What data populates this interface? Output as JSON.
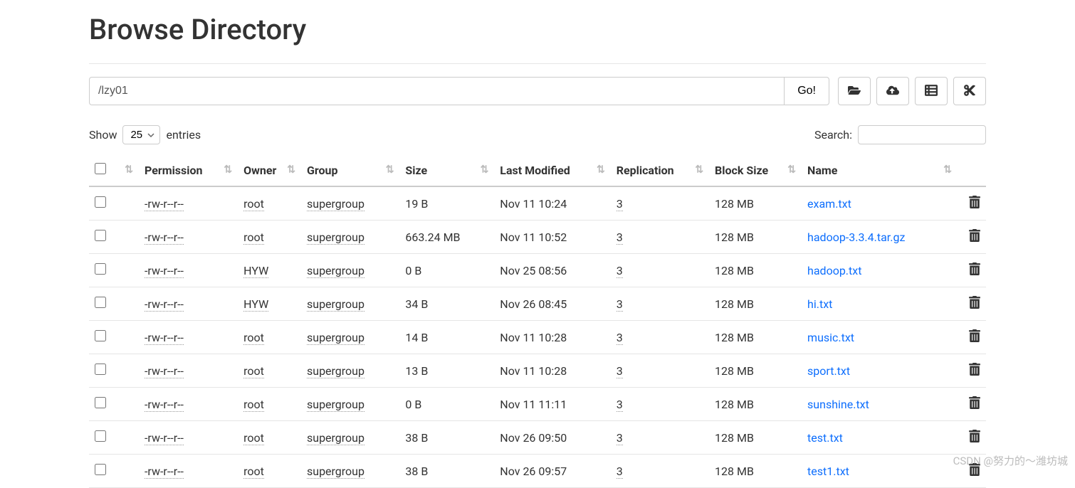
{
  "page": {
    "title": "Browse Directory"
  },
  "path": {
    "value": "/lzy01",
    "go_label": "Go!"
  },
  "controls": {
    "show_label": "Show",
    "entries_label": "entries",
    "page_size": "25",
    "search_label": "Search:",
    "search_value": ""
  },
  "columns": {
    "permission": "Permission",
    "owner": "Owner",
    "group": "Group",
    "size": "Size",
    "last_modified": "Last Modified",
    "replication": "Replication",
    "block_size": "Block Size",
    "name": "Name"
  },
  "rows": [
    {
      "permission": "-rw-r--r--",
      "owner": "root",
      "group": "supergroup",
      "size": "19 B",
      "last_modified": "Nov 11 10:24",
      "replication": "3",
      "block_size": "128 MB",
      "name": "exam.txt"
    },
    {
      "permission": "-rw-r--r--",
      "owner": "root",
      "group": "supergroup",
      "size": "663.24 MB",
      "last_modified": "Nov 11 10:52",
      "replication": "3",
      "block_size": "128 MB",
      "name": "hadoop-3.3.4.tar.gz"
    },
    {
      "permission": "-rw-r--r--",
      "owner": "HYW",
      "group": "supergroup",
      "size": "0 B",
      "last_modified": "Nov 25 08:56",
      "replication": "3",
      "block_size": "128 MB",
      "name": "hadoop.txt"
    },
    {
      "permission": "-rw-r--r--",
      "owner": "HYW",
      "group": "supergroup",
      "size": "34 B",
      "last_modified": "Nov 26 08:45",
      "replication": "3",
      "block_size": "128 MB",
      "name": "hi.txt"
    },
    {
      "permission": "-rw-r--r--",
      "owner": "root",
      "group": "supergroup",
      "size": "14 B",
      "last_modified": "Nov 11 10:28",
      "replication": "3",
      "block_size": "128 MB",
      "name": "music.txt"
    },
    {
      "permission": "-rw-r--r--",
      "owner": "root",
      "group": "supergroup",
      "size": "13 B",
      "last_modified": "Nov 11 10:28",
      "replication": "3",
      "block_size": "128 MB",
      "name": "sport.txt"
    },
    {
      "permission": "-rw-r--r--",
      "owner": "root",
      "group": "supergroup",
      "size": "0 B",
      "last_modified": "Nov 11 11:11",
      "replication": "3",
      "block_size": "128 MB",
      "name": "sunshine.txt"
    },
    {
      "permission": "-rw-r--r--",
      "owner": "root",
      "group": "supergroup",
      "size": "38 B",
      "last_modified": "Nov 26 09:50",
      "replication": "3",
      "block_size": "128 MB",
      "name": "test.txt"
    },
    {
      "permission": "-rw-r--r--",
      "owner": "root",
      "group": "supergroup",
      "size": "38 B",
      "last_modified": "Nov 26 09:57",
      "replication": "3",
      "block_size": "128 MB",
      "name": "test1.txt"
    }
  ],
  "watermark": "CSDN @努力的～潍坊城"
}
